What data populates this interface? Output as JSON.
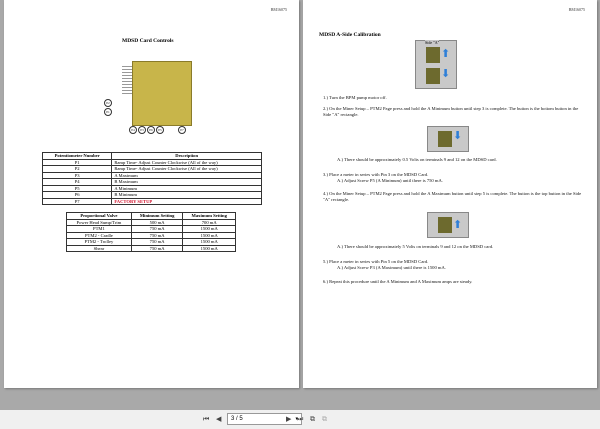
{
  "doc_id": "BM16075",
  "left": {
    "title": "MDSD Card Controls",
    "callouts": [
      "P2",
      "P1",
      "P4",
      "P3",
      "P6",
      "P5",
      "P7"
    ],
    "pot_table": {
      "headers": [
        "Potentiometer Number",
        "Description"
      ],
      "rows": [
        [
          "P1",
          "Ramp Time- Adjust Counter Clockwise (All of the way)"
        ],
        [
          "P2",
          "Ramp Time- Adjust Counter Clockwise (All of the way)"
        ],
        [
          "P3",
          "A Maximum"
        ],
        [
          "P4",
          "B Maximum"
        ],
        [
          "P5",
          "A Minimum"
        ],
        [
          "P6",
          "B Minimum"
        ],
        [
          "P7",
          "FACTORY SETUP"
        ]
      ]
    },
    "valve_table": {
      "headers": [
        "Proportional Valve",
        "Minimum Setting",
        "Maximum Setting"
      ],
      "rows": [
        [
          "Power Head Sump/Trim",
          "500 mA",
          "700 mA"
        ],
        [
          "PTM1",
          "750 mA",
          "1500 mA"
        ],
        [
          "PTM2 - Cradle",
          "750 mA",
          "1500 mA"
        ],
        [
          "PTM2 - Trolley",
          "750 mA",
          "1500 mA"
        ],
        [
          "Shear",
          "750 mA",
          "1500 mA"
        ]
      ]
    }
  },
  "right": {
    "title": "MDSD A-Side Calibration",
    "side_label": "Side \"A\"",
    "steps": [
      "1.) Turn the BPM pump motor off.",
      "2.) On the Miner Setup – PTM2 Page press and hold the A Minimum button until step 3 is complete.  The button is the bottom button in the Side \"A\" rectangle.",
      "A.) There should be approximately 0.5 Volts on terminals 9 and 12 on the MDSD card.",
      "3.) Place a meter in series with Pin 3 on the MDSD Card.",
      "A.) Adjust Screw P5 (A Minimum) until there is 750 mA.",
      "4.) On the Miner Setup – PTM2 Page press and hold the A Maximum button until step 5 is complete.  The button is the top button in the Side \"A\" rectangle.",
      "A.) There should be approximately 5 Volts on terminals 9 and 12 on the MDSD card.",
      "5.) Place a meter in series with Pin 5 on the MDSD Card.",
      "A.) Adjust Screw P3 (A Maximum) until there is 1500 mA.",
      "6.) Repeat this procedure until the A Minimum and A Maximum amps are steady."
    ]
  },
  "toolbar": {
    "page_value": "3 / 5"
  }
}
